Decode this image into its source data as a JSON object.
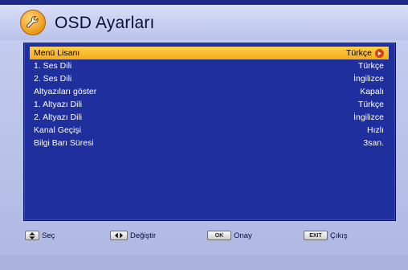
{
  "header": {
    "title": "OSD Ayarları",
    "icon": "wrench-icon"
  },
  "menu": {
    "items": [
      {
        "label": "Menü Lisanı",
        "value": "Türkçe",
        "selected": true
      },
      {
        "label": "1. Ses Dili",
        "value": "Türkçe"
      },
      {
        "label": "2. Ses Dili",
        "value": "İngilizce"
      },
      {
        "label": "Altyazıları göster",
        "value": "Kapalı"
      },
      {
        "label": "1. Altyazı Dili",
        "value": "Türkçe"
      },
      {
        "label": "2. Altyazı Dili",
        "value": "İngilizce"
      },
      {
        "label": "Kanal Geçişi",
        "value": "Hızlı"
      },
      {
        "label": "Bilgi Barı Süresi",
        "value": "3san."
      }
    ]
  },
  "footer": {
    "select": {
      "label": "Seç"
    },
    "change": {
      "label": "Değiştir"
    },
    "confirm": {
      "key": "OK",
      "label": "Onay"
    },
    "exit": {
      "key": "EXIT",
      "label": "Çıkış"
    }
  },
  "colors": {
    "panel": "#1f2f9e",
    "highlight": "#f5b020",
    "background": "#b8c2e8"
  }
}
